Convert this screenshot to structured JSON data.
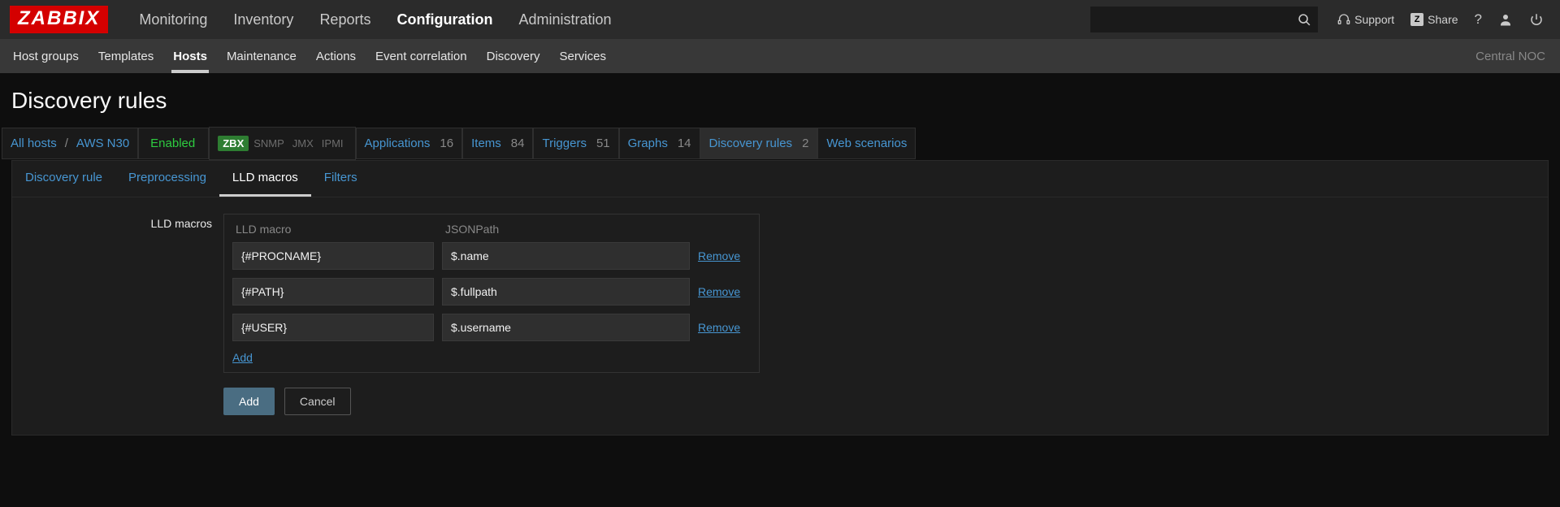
{
  "brand": "ZABBIX",
  "topnav": {
    "items": [
      "Monitoring",
      "Inventory",
      "Reports",
      "Configuration",
      "Administration"
    ],
    "active": "Configuration",
    "support": "Support",
    "share": "Share"
  },
  "subnav": {
    "items": [
      "Host groups",
      "Templates",
      "Hosts",
      "Maintenance",
      "Actions",
      "Event correlation",
      "Discovery",
      "Services"
    ],
    "active": "Hosts",
    "right": "Central NOC"
  },
  "page_title": "Discovery rules",
  "crumbs": {
    "all_hosts": "All hosts",
    "host": "AWS N30",
    "enabled": "Enabled",
    "proto_on": "ZBX",
    "proto_off": [
      "SNMP",
      "JMX",
      "IPMI"
    ],
    "links": [
      {
        "label": "Applications",
        "count": "16"
      },
      {
        "label": "Items",
        "count": "84"
      },
      {
        "label": "Triggers",
        "count": "51"
      },
      {
        "label": "Graphs",
        "count": "14"
      },
      {
        "label": "Discovery rules",
        "count": "2",
        "active": true
      },
      {
        "label": "Web scenarios",
        "count": ""
      }
    ]
  },
  "form_tabs": {
    "items": [
      "Discovery rule",
      "Preprocessing",
      "LLD macros",
      "Filters"
    ],
    "active": "LLD macros"
  },
  "form": {
    "section_label": "LLD macros",
    "col_macro": "LLD macro",
    "col_json": "JSONPath",
    "rows": [
      {
        "macro": "{#PROCNAME}",
        "json": "$.name"
      },
      {
        "macro": "{#PATH}",
        "json": "$.fullpath"
      },
      {
        "macro": "{#USER}",
        "json": "$.username"
      }
    ],
    "remove": "Remove",
    "add_link": "Add",
    "submit": "Add",
    "cancel": "Cancel"
  }
}
